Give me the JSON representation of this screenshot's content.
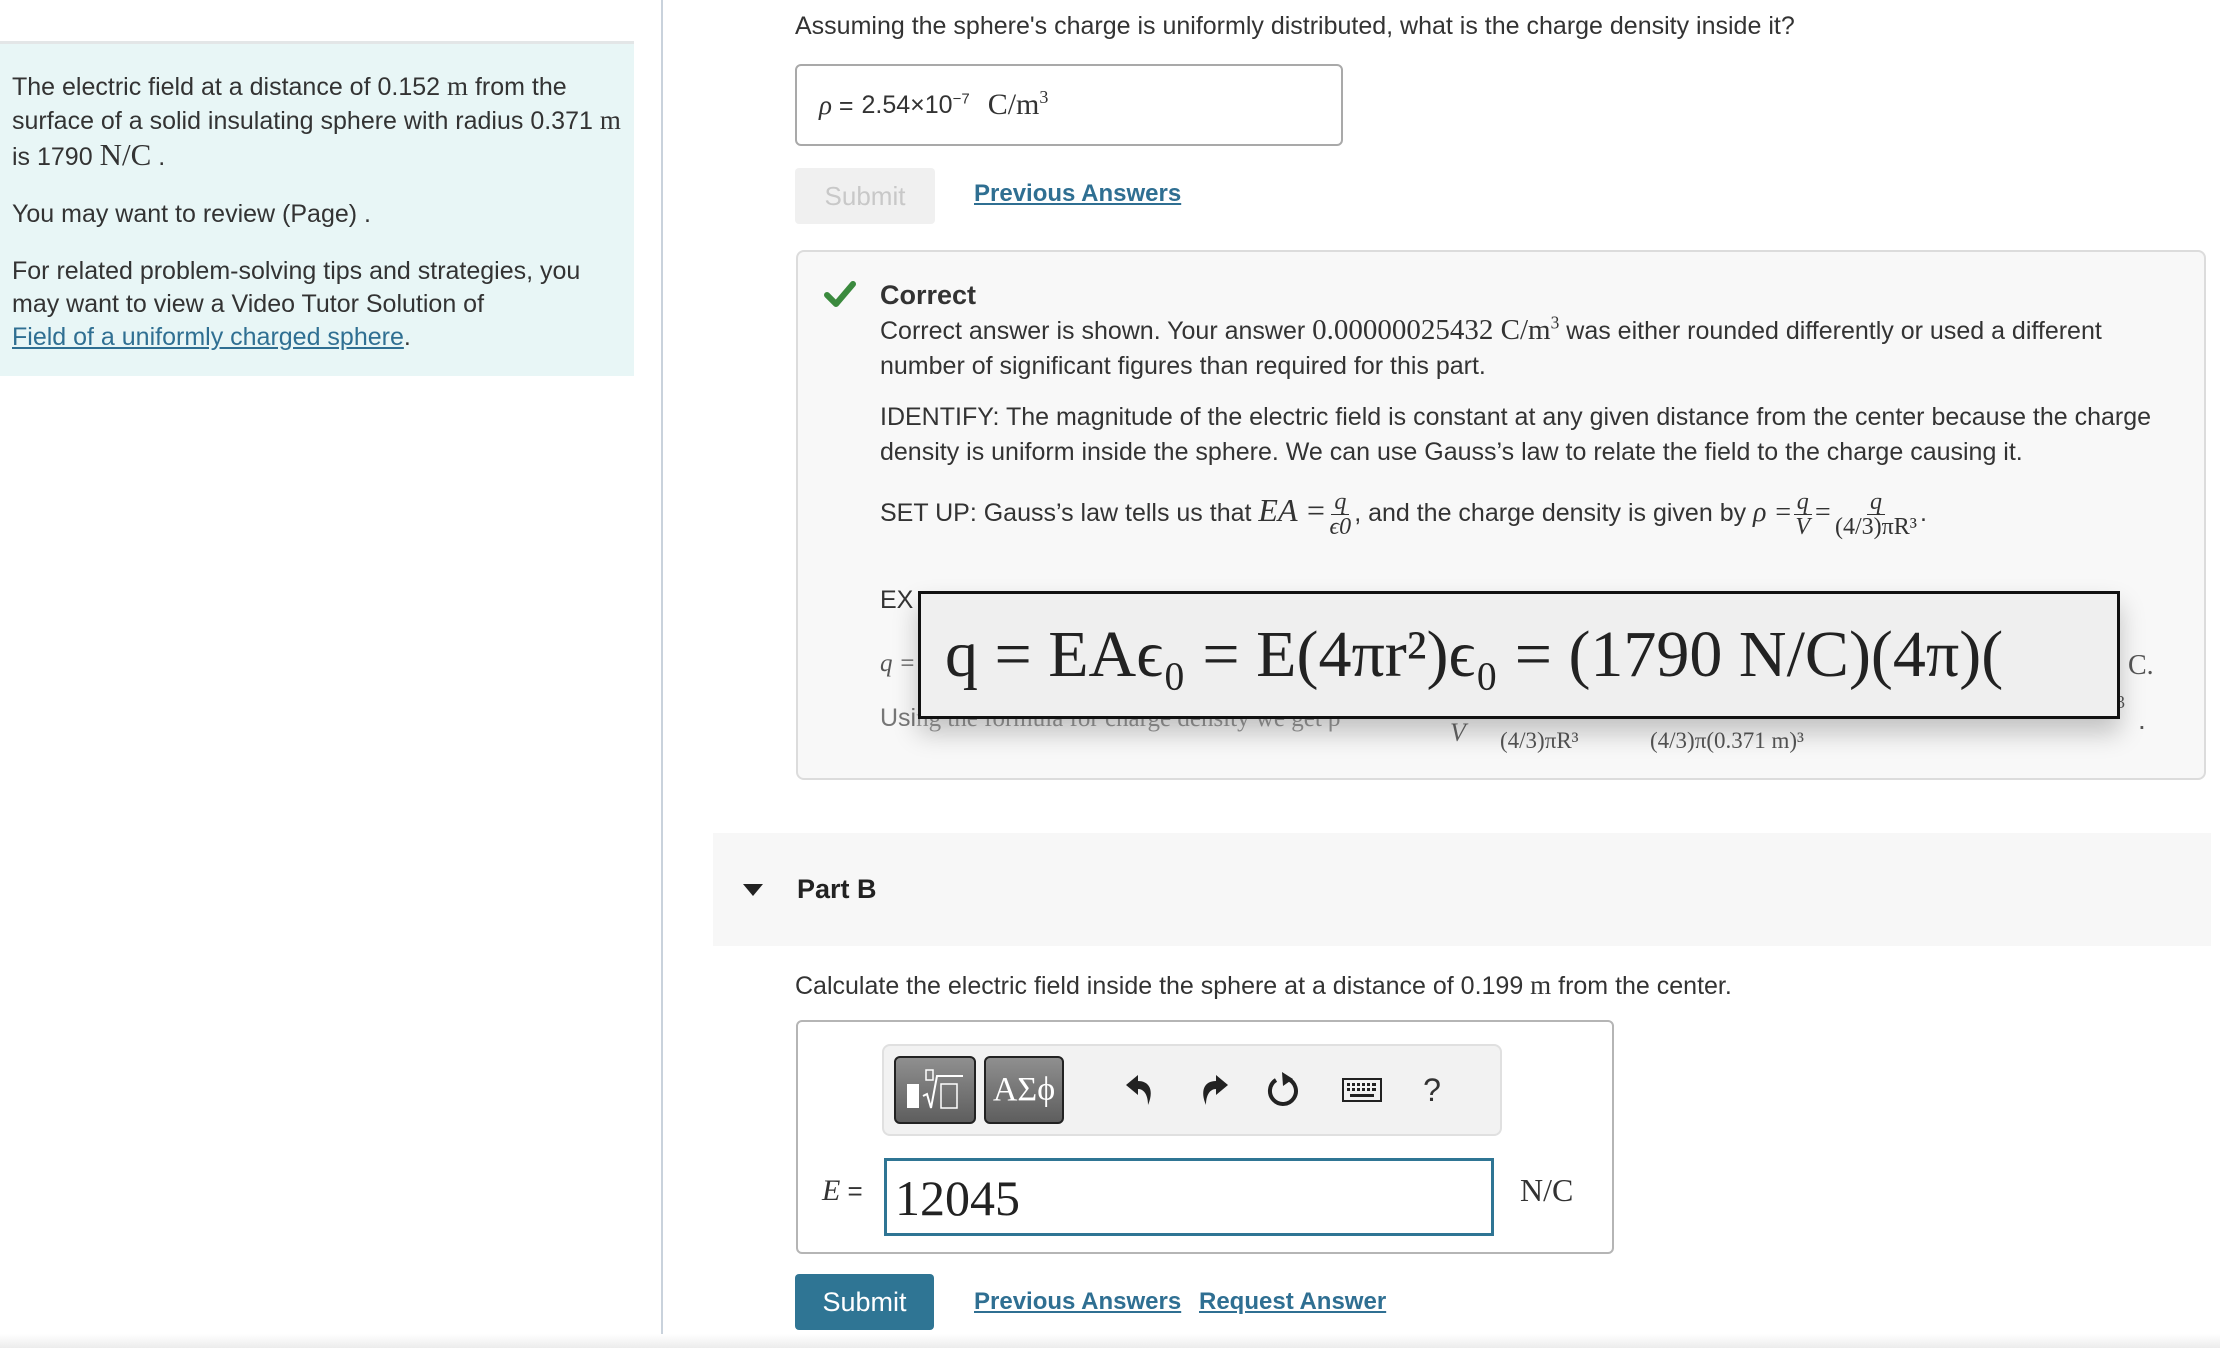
{
  "intro": {
    "p1_pre": "The electric field at a distance of 0.152 ",
    "p1_unit_m": "m",
    "p1_mid": " from the surface of a solid insulating sphere with radius 0.371 ",
    "p1_unit_m2": "m",
    "p1_is": " is 1790 ",
    "p1_unit_nc": "N/C",
    "p1_end": " .",
    "p2": "You may want to review (Page) .",
    "p3": "For related problem-solving tips and strategies, you may want to view a Video Tutor Solution of",
    "p3_link": "Field of a uniformly charged sphere",
    "p3_end": "."
  },
  "part_a": {
    "question": "Assuming the sphere's charge is uniformly distributed, what is the charge density inside it?",
    "answer_label": "ρ =",
    "answer_value": "2.54×10",
    "answer_exp": "−7",
    "answer_unit": "C/m",
    "answer_unit_exp": "3",
    "submit_label": "Submit",
    "previous_answers": "Previous Answers",
    "feedback": {
      "status": "Correct",
      "status_color": "#3b8a3e",
      "line1_pre": "Correct answer is shown. Your answer ",
      "line1_value": "0.00000025432 C/m",
      "line1_exp": "3",
      "line1_post": " was either rounded differently or used a different number of significant figures than required for this part.",
      "identify": "IDENTIFY: The magnitude of the electric field is constant at any given distance from the center because the charge density is uniform inside the sphere. We can use Gauss’s law to relate the field to the charge causing it.",
      "setup_pre": "SET UP: Gauss’s law tells us that ",
      "setup_ea": "EA =",
      "setup_frac1_num": "q",
      "setup_frac1_den": "ϵ0",
      "setup_mid": ", and the charge density is given by ",
      "setup_rho": "ρ =",
      "setup_frac2_num": "q",
      "setup_frac2_den": "V",
      "setup_frac3_num": "q",
      "setup_frac3_den": "(4/3)πR³",
      "setup_end": ".",
      "execute_label": "EX",
      "q_label": "q =",
      "using_label": "Usi",
      "using_ghost": "ng the formula for charge density we get ρ",
      "den_v": "V",
      "den_r": "(4/3)πR³",
      "den_num": "(4/3)π(0.371 m)³",
      "tail_c": "C.",
      "tail_3": "3",
      "tail_dot": ".",
      "magnified_equation": "q = EAϵ₀ = E(4πr²)ϵ₀ = (1790 N/C)(4π)("
    }
  },
  "part_b": {
    "title": "Part B",
    "question_pre": "Calculate the electric field inside the sphere at a distance of 0.199 ",
    "question_unit": "m",
    "question_post": " from the center.",
    "toolbar": {
      "templates_icon": "templates-sqrt-icon",
      "symbols_label": "ΑΣϕ",
      "undo_icon": "undo-icon",
      "redo_icon": "redo-icon",
      "reset_icon": "reset-icon",
      "keyboard_icon": "keyboard-icon",
      "help_label": "?"
    },
    "input_label": "E =",
    "input_value": "12045",
    "unit": "N/C",
    "submit_label": "Submit",
    "previous_answers": "Previous Answers",
    "request_answer": "Request Answer"
  },
  "colors": {
    "accent": "#2f7594",
    "link": "#2f6f92",
    "intro_bg": "#e8f6f6",
    "correct_green": "#3b8a3e"
  }
}
